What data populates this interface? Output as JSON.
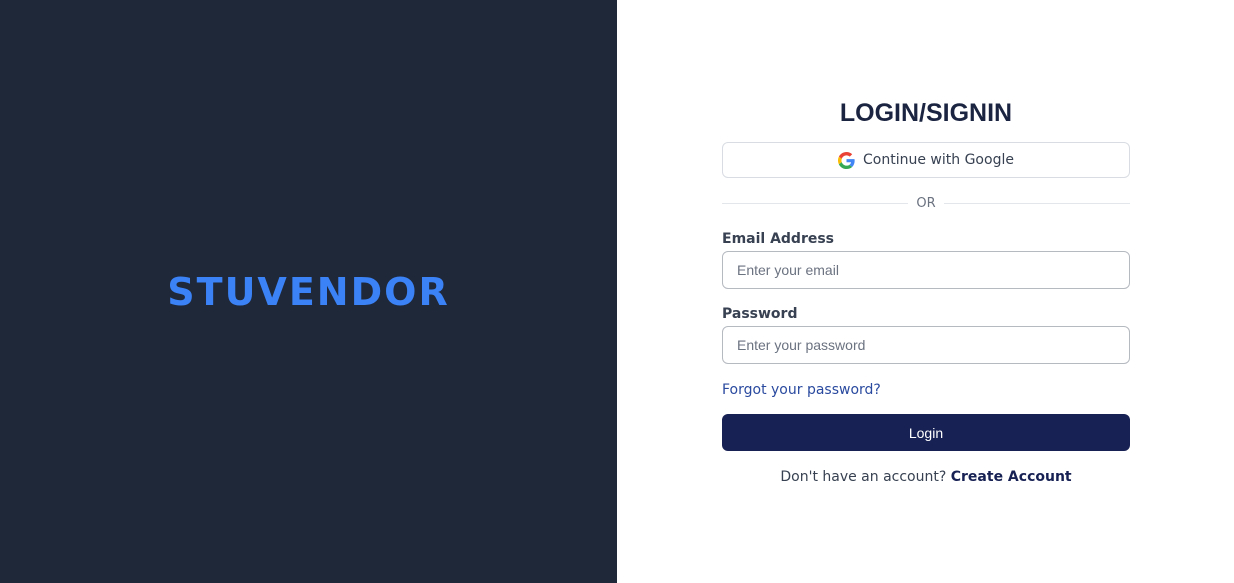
{
  "brand": {
    "name": "STUVENDOR",
    "color": "#3b82f6"
  },
  "left_panel": {
    "background": "#1e2839"
  },
  "form": {
    "title": "LOGIN/SIGNIN",
    "google_button": {
      "label": "Continue with Google",
      "icon": "google-icon"
    },
    "divider_text": "OR",
    "email": {
      "label": "Email Address",
      "value": "",
      "placeholder": "Enter your email"
    },
    "password": {
      "label": "Password",
      "value": "",
      "placeholder": "Enter your password"
    },
    "forgot_link": "Forgot your password?",
    "login_button": "Login",
    "signup_prompt": "Don't have an account?",
    "signup_link": "Create Account",
    "accent_color": "#172153"
  }
}
